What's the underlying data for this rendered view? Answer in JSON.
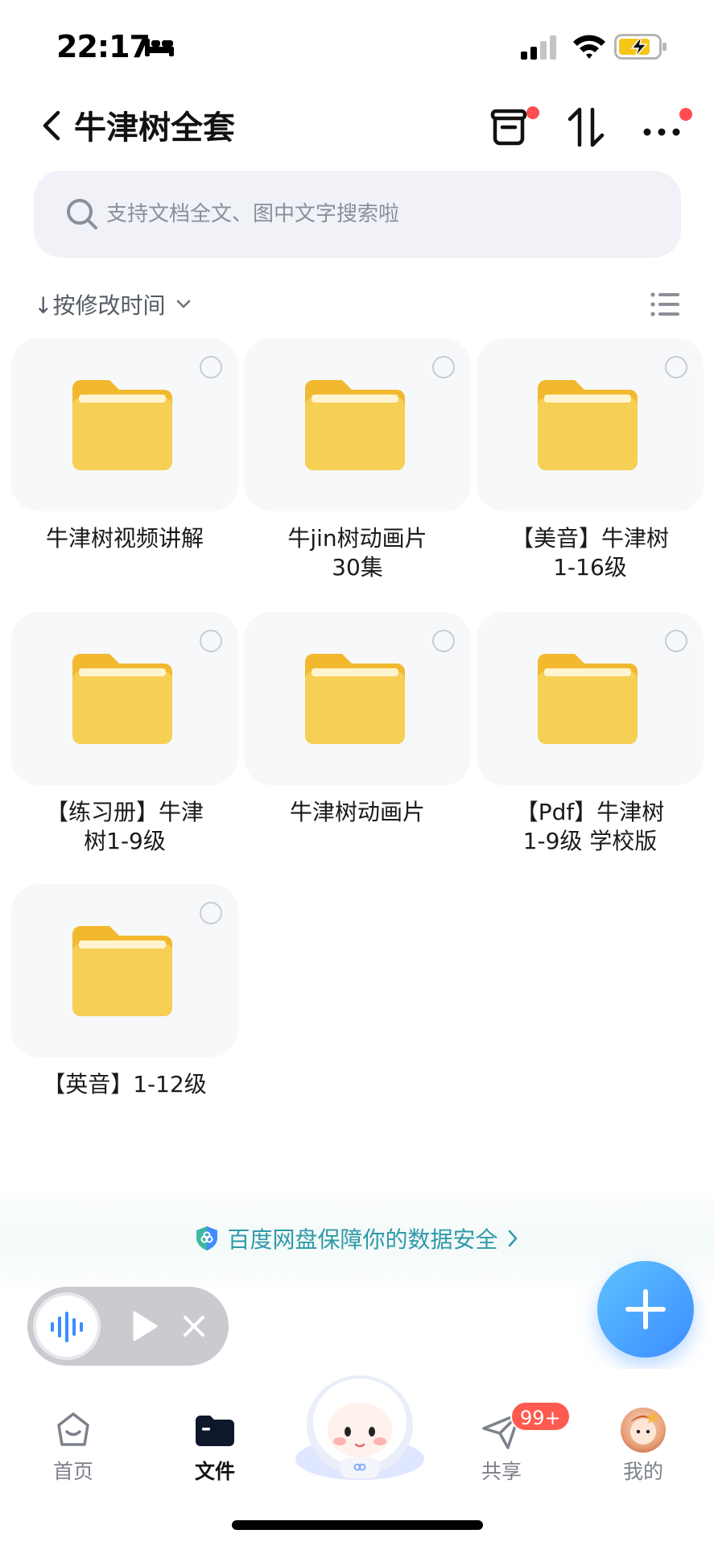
{
  "status_bar": {
    "time": "22:17"
  },
  "header": {
    "title": "牛津树全套"
  },
  "search": {
    "placeholder": "支持文档全文、图中文字搜索啦"
  },
  "sort": {
    "label": "↓按修改时间"
  },
  "folders": [
    {
      "name": "牛津树视频讲解"
    },
    {
      "name": "牛jin树动画片\n30集"
    },
    {
      "name": "【美音】牛津树\n1-16级"
    },
    {
      "name": "【练习册】牛津\n树1-9级"
    },
    {
      "name": "牛津树动画片"
    },
    {
      "name": "【Pdf】牛津树\n1-9级 学校版"
    },
    {
      "name": "【英音】1-12级"
    }
  ],
  "security_banner": {
    "text": "百度网盘保障你的数据安全"
  },
  "tabs": [
    {
      "label": "首页",
      "icon": "home-icon"
    },
    {
      "label": "文件",
      "icon": "folder-icon",
      "active": true
    },
    {
      "label": "共享",
      "icon": "paper-plane-icon",
      "badge": "99+"
    },
    {
      "label": "我的",
      "icon": "avatar"
    }
  ],
  "colors": {
    "accent": "#3a8dff",
    "folder": "#f7cd4f",
    "badge": "#ff5a4f",
    "link": "#2f9aa8"
  }
}
